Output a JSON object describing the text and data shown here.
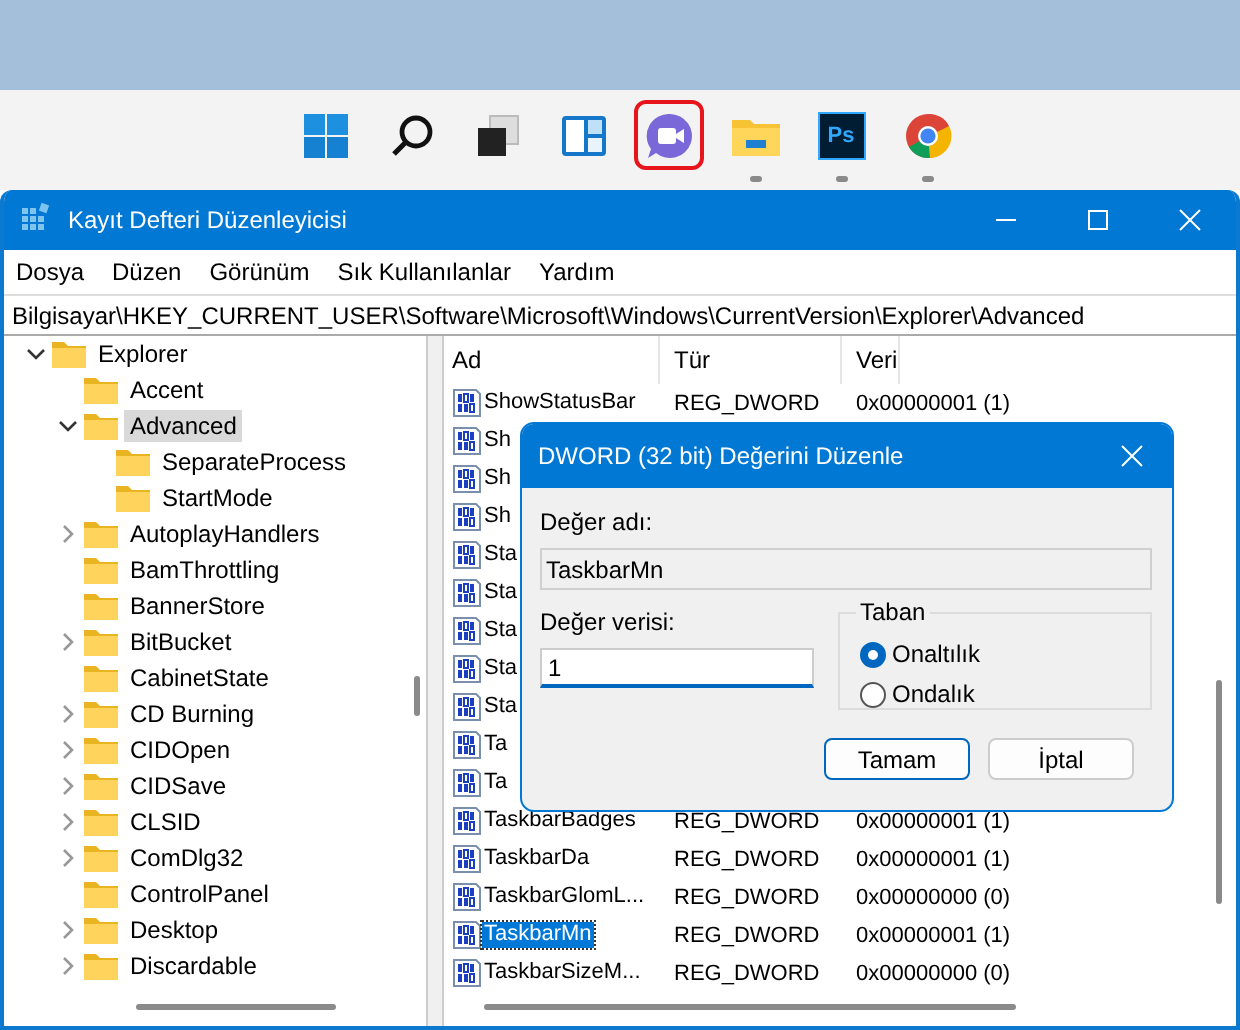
{
  "taskbar": {
    "apps": [
      {
        "kind": "start",
        "running": false,
        "highlighted": false
      },
      {
        "kind": "search",
        "running": false,
        "highlighted": false
      },
      {
        "kind": "taskview",
        "running": false,
        "highlighted": false
      },
      {
        "kind": "widgets",
        "running": false,
        "highlighted": false
      },
      {
        "kind": "chat",
        "running": false,
        "highlighted": true
      },
      {
        "kind": "explorer",
        "running": true,
        "highlighted": false
      },
      {
        "kind": "photoshop",
        "label": "Ps",
        "running": true,
        "highlighted": false
      },
      {
        "kind": "chrome",
        "running": true,
        "highlighted": false
      }
    ]
  },
  "window": {
    "title": "Kayıt Defteri Düzenleyicisi",
    "menu": [
      "Dosya",
      "Düzen",
      "Görünüm",
      "Sık Kullanılanlar",
      "Yardım"
    ],
    "address": "Bilgisayar\\HKEY_CURRENT_USER\\Software\\Microsoft\\Windows\\CurrentVersion\\Explorer\\Advanced",
    "tree": [
      {
        "label": "Explorer",
        "expanded": true,
        "selected": false,
        "children": [
          {
            "label": "Accent",
            "selected": false
          },
          {
            "label": "Advanced",
            "expanded": true,
            "selected": true,
            "children": [
              {
                "label": "SeparateProcess",
                "selected": false
              },
              {
                "label": "StartMode",
                "selected": false
              }
            ]
          },
          {
            "label": "AutoplayHandlers",
            "expanded": false,
            "selected": false
          },
          {
            "label": "BamThrottling",
            "selected": false
          },
          {
            "label": "BannerStore",
            "selected": false
          },
          {
            "label": "BitBucket",
            "expanded": false,
            "selected": false
          },
          {
            "label": "CabinetState",
            "selected": false
          },
          {
            "label": "CD Burning",
            "expanded": false,
            "selected": false
          },
          {
            "label": "CIDOpen",
            "expanded": false,
            "selected": false
          },
          {
            "label": "CIDSave",
            "expanded": false,
            "selected": false
          },
          {
            "label": "CLSID",
            "expanded": false,
            "selected": false
          },
          {
            "label": "ComDlg32",
            "expanded": false,
            "selected": false
          },
          {
            "label": "ControlPanel",
            "selected": false
          },
          {
            "label": "Desktop",
            "expanded": false,
            "selected": false
          },
          {
            "label": "Discardable",
            "expanded": false,
            "selected": false
          }
        ]
      }
    ],
    "list": {
      "columns": [
        "Ad",
        "Tür",
        "Veri"
      ],
      "rows": [
        {
          "name": "ShowStatusBar",
          "type": "REG_DWORD",
          "data": "0x00000001 (1)",
          "selected": false
        },
        {
          "name": "Sh",
          "selected": false
        },
        {
          "name": "Sh",
          "selected": false
        },
        {
          "name": "Sh",
          "selected": false
        },
        {
          "name": "Sta",
          "selected": false
        },
        {
          "name": "Sta",
          "selected": false
        },
        {
          "name": "Sta",
          "selected": false
        },
        {
          "name": "Sta",
          "selected": false
        },
        {
          "name": "Sta",
          "selected": false
        },
        {
          "name": "Ta",
          "selected": false
        },
        {
          "name": "Ta",
          "selected": false
        },
        {
          "name": "TaskbarBadges",
          "type": "REG_DWORD",
          "data": "0x00000001 (1)",
          "selected": false
        },
        {
          "name": "TaskbarDa",
          "type": "REG_DWORD",
          "data": "0x00000001 (1)",
          "selected": false
        },
        {
          "name": "TaskbarGlomL...",
          "type": "REG_DWORD",
          "data": "0x00000000 (0)",
          "selected": false
        },
        {
          "name": "TaskbarMn",
          "type": "REG_DWORD",
          "data": "0x00000001 (1)",
          "selected": true
        },
        {
          "name": "TaskbarSizeM...",
          "type": "REG_DWORD",
          "data": "0x00000000 (0)",
          "selected": false
        }
      ]
    }
  },
  "dialog": {
    "title": "DWORD (32 bit) Değerini Düzenle",
    "name_label": "Değer adı:",
    "name_value": "TaskbarMn",
    "data_label": "Değer verisi:",
    "data_value": "1",
    "base": {
      "title": "Taban",
      "options": [
        {
          "label": "Onaltılık",
          "selected": true
        },
        {
          "label": "Ondalık",
          "selected": false
        }
      ]
    },
    "buttons": [
      {
        "label": "Tamam",
        "default": true
      },
      {
        "label": "İptal",
        "default": false
      }
    ]
  }
}
